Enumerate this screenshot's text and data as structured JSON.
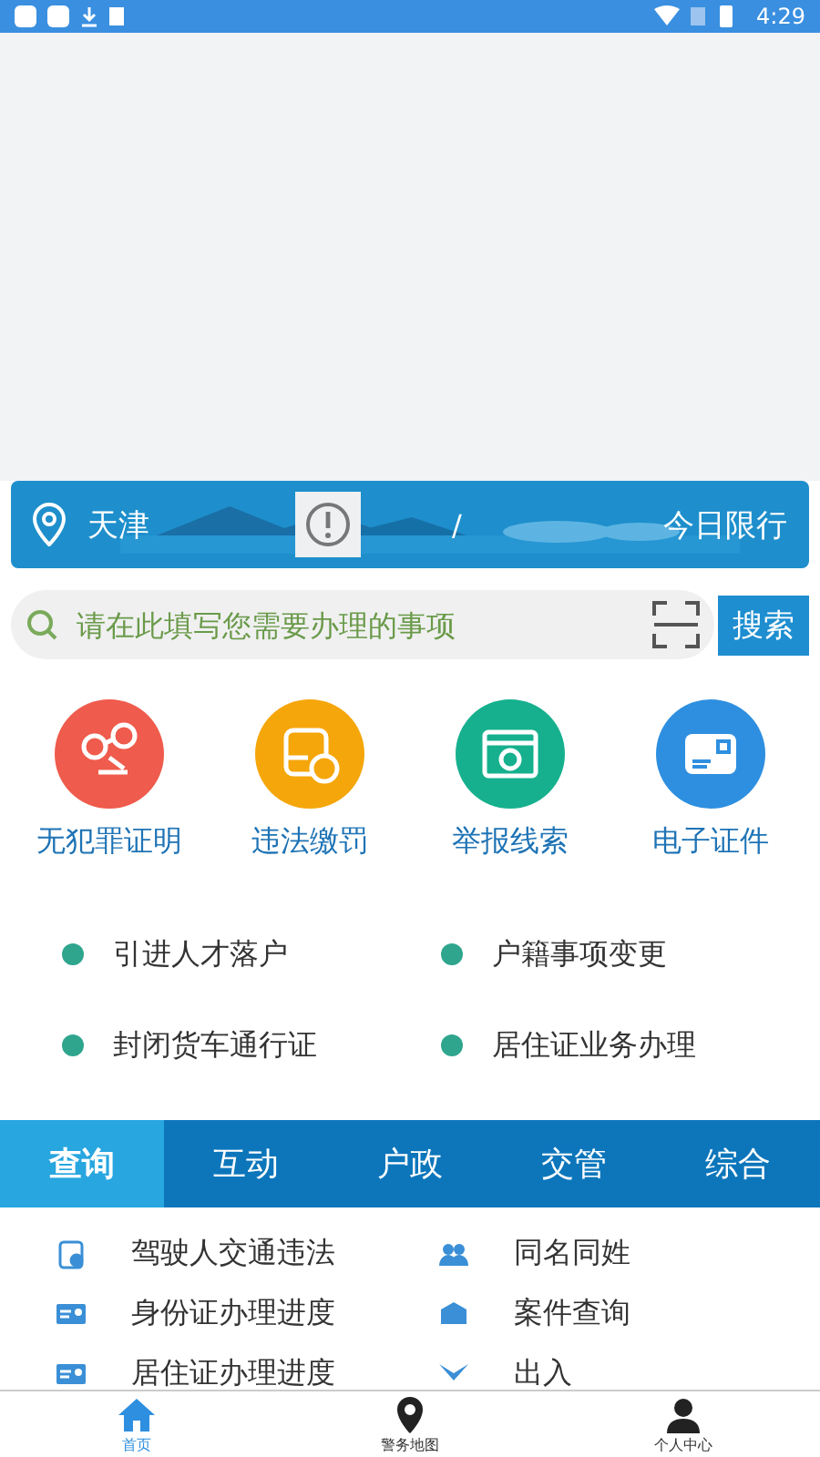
{
  "status_bar": {
    "time": "4:29"
  },
  "banner": {
    "city": "天津",
    "separator": "/",
    "restriction": "今日限行"
  },
  "search": {
    "placeholder": "请在此填写您需要办理的事项",
    "button": "搜索"
  },
  "services": [
    {
      "label": "无犯罪证明",
      "color": "#ef5b4c",
      "kind": "handcuffs"
    },
    {
      "label": "违法缴罚",
      "color": "#f5a60a",
      "kind": "fine"
    },
    {
      "label": "举报线索",
      "color": "#16b08e",
      "kind": "camera"
    },
    {
      "label": "电子证件",
      "color": "#2e8fe0",
      "kind": "card"
    }
  ],
  "quick_links": [
    "引进人才落户",
    "户籍事项变更",
    "封闭货车通行证",
    "居住证业务办理"
  ],
  "tabs": [
    {
      "label": "查询",
      "selected": true
    },
    {
      "label": "互动",
      "selected": false
    },
    {
      "label": "户政",
      "selected": false
    },
    {
      "label": "交管",
      "selected": false
    },
    {
      "label": "综合",
      "selected": false
    }
  ],
  "query_items": [
    {
      "label": "驾驶人交通违法",
      "kind": "clipboard"
    },
    {
      "label": "同名同姓",
      "kind": "people"
    },
    {
      "label": "身份证办理进度",
      "kind": "idcard"
    },
    {
      "label": "案件查询",
      "kind": "box"
    },
    {
      "label": "居住证办理进度",
      "kind": "idcard"
    },
    {
      "label": "出入",
      "kind": "plane"
    }
  ],
  "bottom_nav": [
    {
      "label": "首页",
      "kind": "home",
      "selected": true
    },
    {
      "label": "警务地图",
      "kind": "pin",
      "selected": false
    },
    {
      "label": "个人中心",
      "kind": "person",
      "selected": false
    }
  ]
}
